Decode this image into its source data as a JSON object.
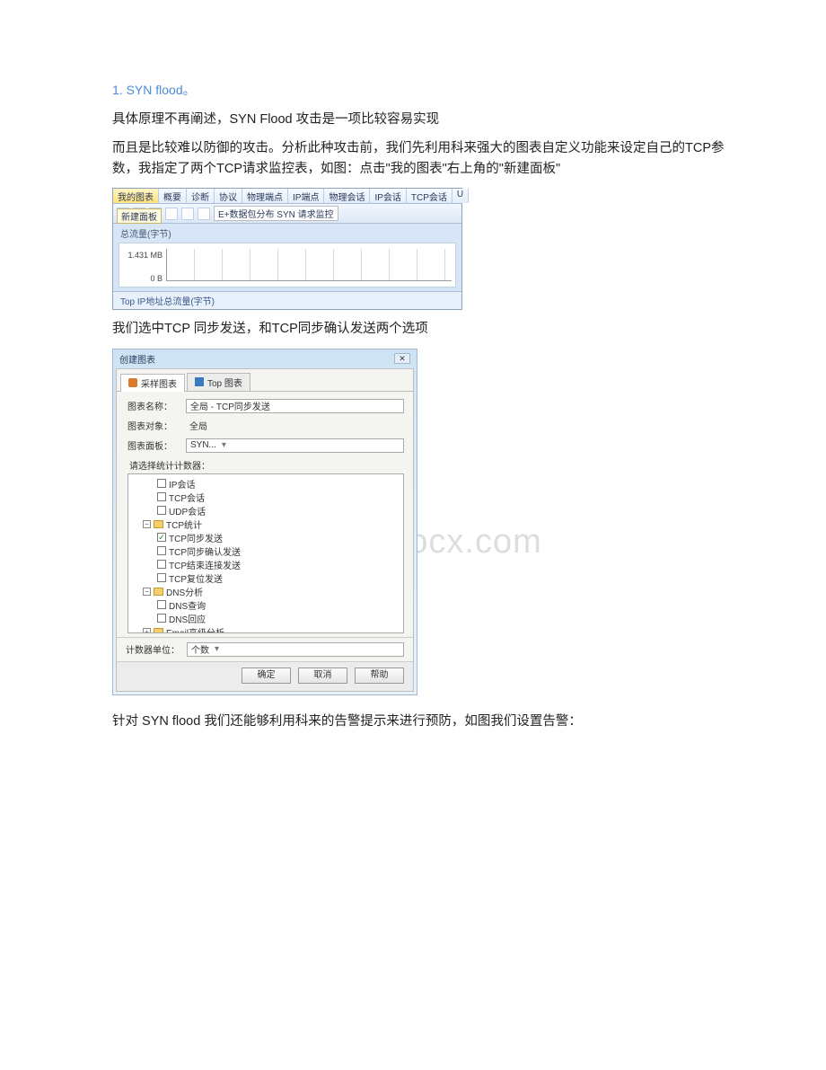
{
  "heading": "1. SYN flood。",
  "para1": "具体原理不再阐述，SYN Flood 攻击是一项比较容易实现",
  "para2": "而且是比较难以防御的攻击。分析此种攻击前，我们先利用科来强大的图表自定义功能来设定自己的TCP参数，我指定了两个TCP请求监控表，如图：点击\"我的图表\"右上角的\"新建面板\"",
  "para3": "我们选中TCP 同步发送，和TCP同步确认发送两个选项",
  "para4": "针对 SYN flood 我们还能够利用科来的告警提示来进行预防，如图我们设置告警：",
  "watermark": "www.bdocx.com",
  "ss1": {
    "tabs": [
      "我的图表",
      "概要",
      "诊断",
      "协议",
      "物理端点",
      "IP端点",
      "物理会话",
      "IP会话",
      "TCP会话",
      "U"
    ],
    "activeTab": 0,
    "newPanel": "新建面板",
    "toolbarText": "E+数据包分布   SYN  请求监控",
    "subhead": "总流量(字节)",
    "y1": "1.431 MB",
    "y2": "0 B",
    "footer": "Top IP地址总流量(字节)"
  },
  "ss2": {
    "title": "创建图表",
    "tab1": "采样图表",
    "tab2": "Top 图表",
    "lbl_name": "图表名称：",
    "val_name": "全局 - TCP同步发送",
    "lbl_target": "图表对象：",
    "val_target": "全局",
    "lbl_panel": "图表面板：",
    "val_panel": "SYN...",
    "section": "请选择统计计数器：",
    "tree": {
      "ip": "IP会话",
      "tcpSess": "TCP会话",
      "udp": "UDP会话",
      "tcpStat": "TCP统计",
      "syn": "TCP同步发送",
      "synAck": "TCP同步确认发送",
      "fin": "TCP结束连接发送",
      "rst": "TCP复位发送",
      "dns": "DNS分析",
      "dnsQ": "DNS查询",
      "dnsR": "DNS回应",
      "email": "Email高级分析"
    },
    "unitLabel": "计数器单位：",
    "unitValue": "个数",
    "btn_ok": "确定",
    "btn_cancel": "取消",
    "btn_help": "帮助"
  }
}
